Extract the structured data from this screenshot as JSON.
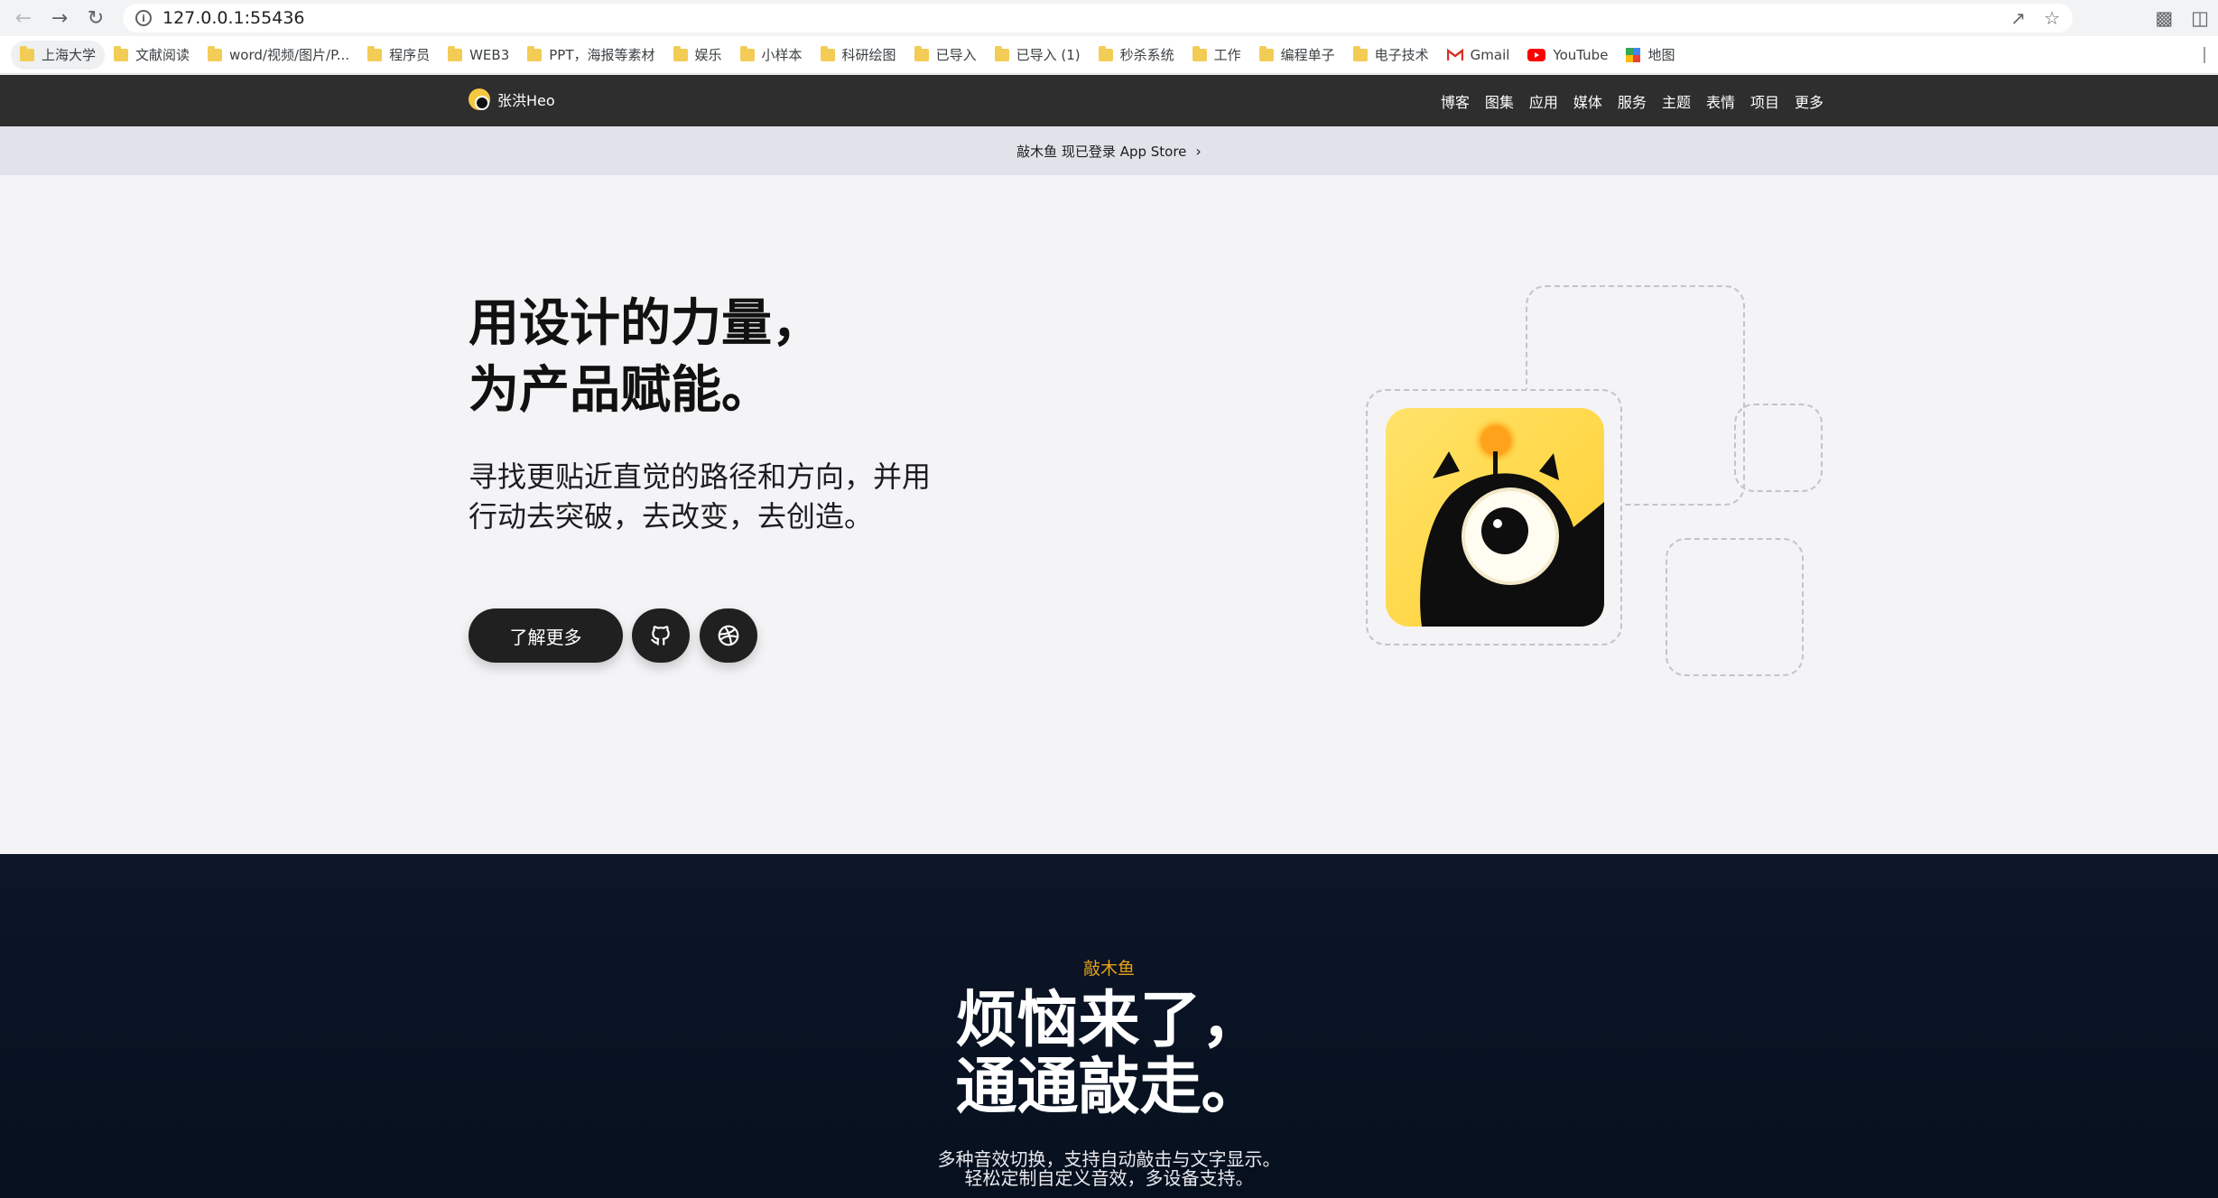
{
  "browser": {
    "url": "127.0.0.1:55436",
    "bookmarks": [
      {
        "label": "上海大学"
      },
      {
        "label": "文献阅读"
      },
      {
        "label": "word/视频/图片/P..."
      },
      {
        "label": "程序员"
      },
      {
        "label": "WEB3"
      },
      {
        "label": "PPT，海报等素材"
      },
      {
        "label": "娱乐"
      },
      {
        "label": "小样本"
      },
      {
        "label": "科研绘图"
      },
      {
        "label": "已导入"
      },
      {
        "label": "已导入 (1)"
      },
      {
        "label": "秒杀系统"
      },
      {
        "label": "工作"
      },
      {
        "label": "编程单子"
      },
      {
        "label": "电子技术"
      },
      {
        "label": "Gmail"
      },
      {
        "label": "YouTube"
      },
      {
        "label": "地图"
      }
    ]
  },
  "site": {
    "brand": "张洪Heo",
    "nav": [
      "博客",
      "图集",
      "应用",
      "媒体",
      "服务",
      "主题",
      "表情",
      "项目",
      "更多"
    ],
    "banner": {
      "text": "敲木鱼 现已登录 App Store",
      "chevron": "›"
    }
  },
  "hero": {
    "title_line1": "用设计的力量，",
    "title_line2": "为产品赋能。",
    "subtitle_line1": "寻找更贴近直觉的路径和方向，并用",
    "subtitle_line2": "行动去突破，去改变，去创造。",
    "cta_label": "了解更多",
    "icons": [
      "github-icon",
      "dribbble-icon"
    ]
  },
  "feature": {
    "kicker": "敲木鱼",
    "title_line1": "烦恼来了，",
    "title_line2": "通通敲走。",
    "desc_line1": "多种音效切换，支持自动敲击与文字显示。",
    "desc_line2": "轻松定制自定义音效，多设备支持。"
  },
  "colors": {
    "nav_bg": "#2e2e2e",
    "banner_bg": "#e0e3ea",
    "hero_bg": "#f4f4f6",
    "dark_bg": "#0c1628",
    "accent": "#e6a117",
    "app_icon_bg": "#ffd84a"
  }
}
